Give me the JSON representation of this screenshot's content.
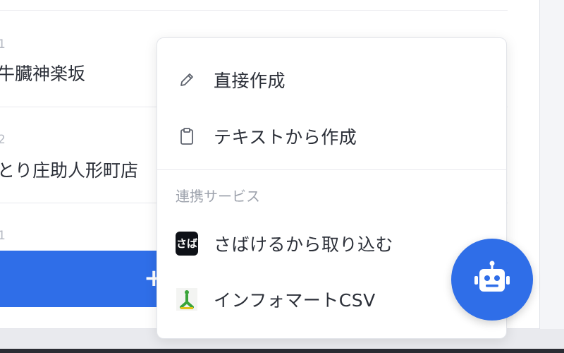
{
  "list": {
    "rows": [
      {
        "code": "1",
        "name": "牛臓神楽坂"
      },
      {
        "code": "2",
        "name": "とり庄助人形町店"
      },
      {
        "code": "1",
        "name": ""
      }
    ],
    "add_label": "+"
  },
  "menu": {
    "items": [
      {
        "label": "直接作成",
        "icon": "pencil-icon"
      },
      {
        "label": "テキストから作成",
        "icon": "clipboard-icon"
      }
    ],
    "section_label": "連携サービス",
    "integrations": [
      {
        "label": "さばけるから取り込む",
        "icon": "sabakeru-logo-icon",
        "logo_text": "さば"
      },
      {
        "label": "インフォマートCSV",
        "icon": "infomart-logo-icon"
      }
    ]
  },
  "fab": {
    "icon": "robot-icon"
  },
  "colors": {
    "accent": "#2f6ee8",
    "text": "#2b2f38",
    "muted": "#9ea3ad",
    "infomart_green": "#3aa43a",
    "infomart_yellow": "#e2c21a"
  }
}
